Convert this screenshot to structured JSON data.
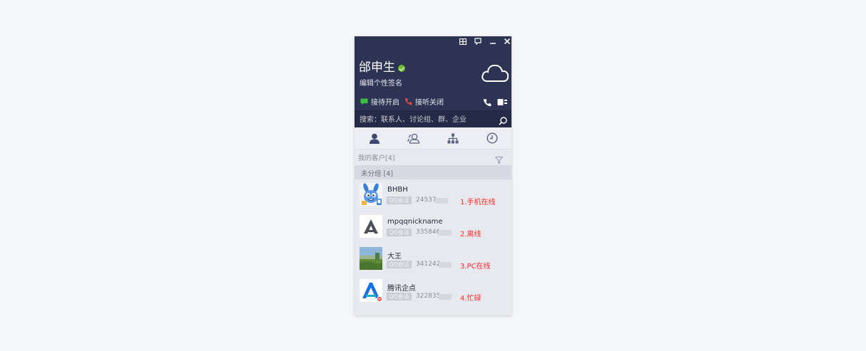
{
  "window_controls": [
    {
      "name": "skin-button",
      "label": "skin"
    },
    {
      "name": "message-button",
      "label": "messages"
    },
    {
      "name": "minimize-button",
      "label": "minimize"
    },
    {
      "name": "close-button",
      "label": "close"
    }
  ],
  "profile": {
    "name": "邰申生",
    "status": "online",
    "signature": "编辑个性签名"
  },
  "actions": {
    "reception": "接待开启",
    "listen": "接听关闭"
  },
  "search": {
    "placeholder": "搜索：联系人、讨论组、群、企业"
  },
  "tabs": [
    {
      "name": "tab-contacts",
      "icon": "person-icon",
      "active": true
    },
    {
      "name": "tab-colleagues",
      "icon": "people-icon",
      "active": false
    },
    {
      "name": "tab-organization",
      "icon": "org-chart-icon",
      "active": false
    },
    {
      "name": "tab-recent",
      "icon": "clock-icon",
      "active": false
    }
  ],
  "group": {
    "title": "我的客户[4]",
    "subgroup": "未分组  [4]"
  },
  "contacts": [
    {
      "name": "BHBH",
      "badge": "QQ会话",
      "id": "24537",
      "note": "1.手机在线",
      "avatar": "rabbit"
    },
    {
      "name": "mpqqnickname",
      "badge": "QQ会话",
      "id": "335846",
      "note": "2.离线",
      "avatar": "grey-a-logo"
    },
    {
      "name": "大王",
      "badge": "QQ会话",
      "id": "341242",
      "note": "3.PC在线",
      "avatar": "landscape"
    },
    {
      "name": "腾讯企点",
      "badge": "QQ会话",
      "id": "322835",
      "note": "4.忙碌",
      "avatar": "blue-a-logo"
    }
  ],
  "colors": {
    "header_bg": "#2d3453",
    "search_bg": "#252b46",
    "online_green": "#6fb936",
    "note_red": "#ff2a2a",
    "tab_icon": "#4a5270"
  }
}
